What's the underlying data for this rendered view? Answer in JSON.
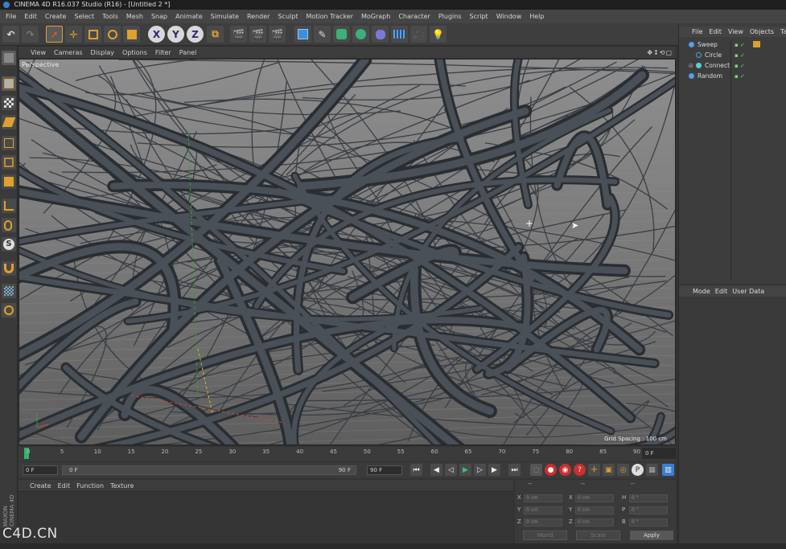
{
  "title_bar": {
    "text": "CINEMA 4D R16.037 Studio (R16) - [Untitled 2 *]"
  },
  "menubar": [
    "File",
    "Edit",
    "Create",
    "Select",
    "Tools",
    "Mesh",
    "Snap",
    "Animate",
    "Simulate",
    "Render",
    "Sculpt",
    "Motion Tracker",
    "MoGraph",
    "Character",
    "Plugins",
    "Script",
    "Window",
    "Help"
  ],
  "toolbar": {
    "undo": "↶",
    "axis_x": "X",
    "axis_y": "Y",
    "axis_z": "Z"
  },
  "viewport": {
    "menu": [
      "View",
      "Cameras",
      "Display",
      "Options",
      "Filter",
      "Panel"
    ],
    "nav_icons": "✥↕⟲▢",
    "label": "Perspective",
    "grid_spacing": "Grid Spacing : 100 cm"
  },
  "timeline": {
    "ticks": [
      "0",
      "5",
      "10",
      "15",
      "20",
      "25",
      "30",
      "35",
      "40",
      "45",
      "50",
      "55",
      "60",
      "65",
      "70",
      "75",
      "80",
      "85",
      "90"
    ],
    "current_frame": "0 F"
  },
  "transport": {
    "start_frame": "0 F",
    "range_start": "0 F",
    "range_end": "90 F",
    "end_frame": "90 F"
  },
  "materials_menu": [
    "Create",
    "Edit",
    "Function",
    "Texture"
  ],
  "coordinates": {
    "header": [
      "--",
      "--",
      "--"
    ],
    "rows": [
      {
        "a": "X",
        "av": "0 cm",
        "b": "X",
        "bv": "0 cm",
        "c": "H",
        "cv": "0 °"
      },
      {
        "a": "Y",
        "av": "0 cm",
        "b": "Y",
        "bv": "0 cm",
        "c": "P",
        "cv": "0 °"
      },
      {
        "a": "Z",
        "av": "0 cm",
        "b": "Z",
        "bv": "0 cm",
        "c": "B",
        "cv": "0 °"
      }
    ],
    "mode_world": "World",
    "mode_scale": "Scale",
    "apply": "Apply"
  },
  "object_manager": {
    "menu": [
      "File",
      "Edit",
      "View",
      "Objects",
      "Tag"
    ],
    "objects": [
      {
        "name": "Sweep",
        "indent": 0,
        "color": "#4ea0e8"
      },
      {
        "name": "Circle",
        "indent": 1,
        "color": "#4ea0e8"
      },
      {
        "name": "Connect",
        "indent": 1,
        "color": "#5bd0d0"
      },
      {
        "name": "Random",
        "indent": 0,
        "color": "#4ea0e8"
      }
    ]
  },
  "attribute_manager": {
    "menu": [
      "Mode",
      "Edit",
      "User Data"
    ]
  },
  "brand": {
    "vertical": "MAXON CINEMA 4D",
    "watermark": "C4D.CN"
  },
  "colors": {
    "accent_blue": "#3a7fd0",
    "timeline_green": "#2fb56a",
    "orange_icon": "#e0a030"
  }
}
